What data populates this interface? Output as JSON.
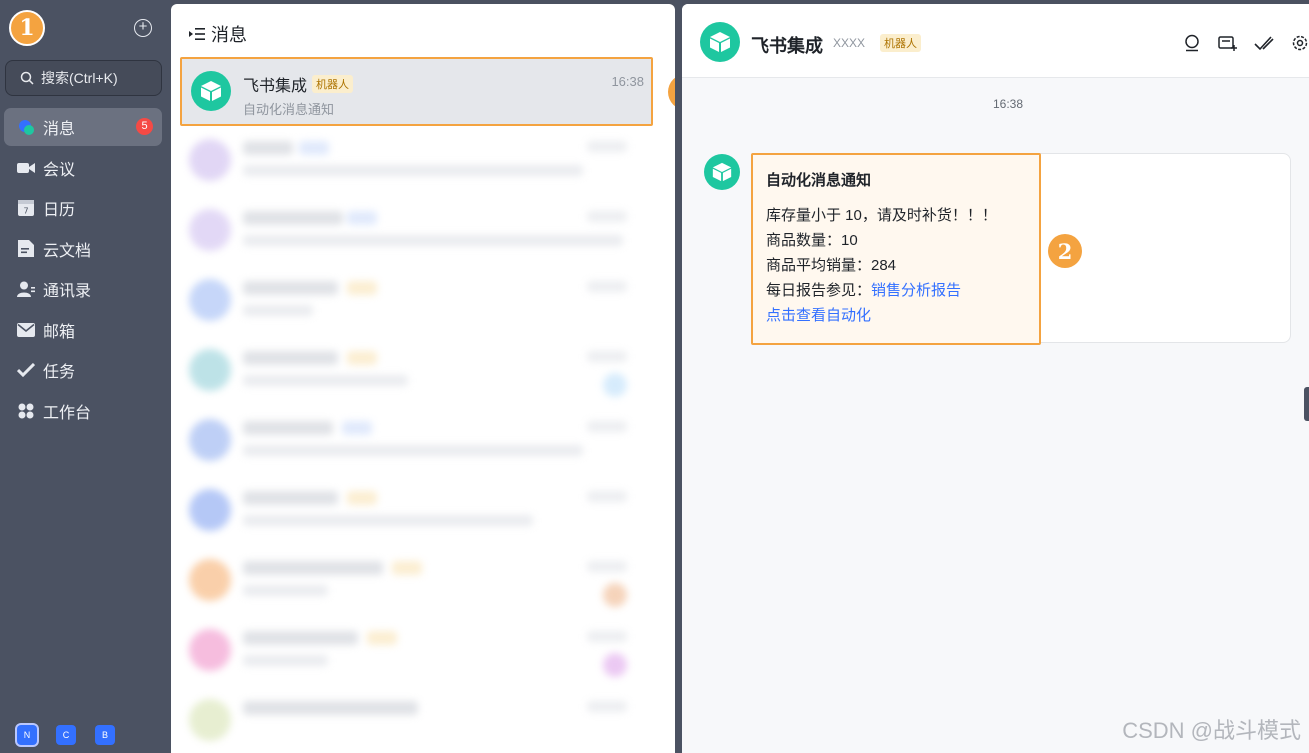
{
  "app": {
    "user_avatar_glyph": "1",
    "search_label": "搜索(Ctrl+K)"
  },
  "sidebar": {
    "items": [
      {
        "label": "消息",
        "icon": "message-icon",
        "badge": "5",
        "active": true
      },
      {
        "label": "会议",
        "icon": "video-icon"
      },
      {
        "label": "日历",
        "icon": "calendar-icon",
        "icon_text": "7"
      },
      {
        "label": "云文档",
        "icon": "document-icon"
      },
      {
        "label": "通讯录",
        "icon": "contacts-icon"
      },
      {
        "label": "邮箱",
        "icon": "mail-icon"
      },
      {
        "label": "任务",
        "icon": "task-check-icon"
      },
      {
        "label": "工作台",
        "icon": "workplace-grid-icon"
      }
    ],
    "bottom_apps": [
      "N",
      "C",
      "B"
    ]
  },
  "message_list": {
    "title": "消息",
    "selected": {
      "name": "飞书集成",
      "tag": "机器人",
      "time": "16:38",
      "preview": "自动化消息通知"
    }
  },
  "annotations": {
    "marker1": "1",
    "marker2": "2"
  },
  "chat": {
    "name": "飞书集成",
    "subtitle": "XXXX",
    "tag": "机器人",
    "timestamp": "16:38",
    "tools": [
      "search-icon",
      "add-window-icon",
      "task-check-icon",
      "settings-icon"
    ],
    "card": {
      "title": "自动化消息通知",
      "line1": "库存量小于 10，请及时补货！！！",
      "line2": "商品数量：10",
      "line3": "商品平均销量：284",
      "line4_prefix": "每日报告参见：",
      "line4_link": "销售分析报告",
      "link2": "点击查看自动化"
    }
  },
  "watermark": "CSDN @战斗模式",
  "colors": {
    "accent_orange": "#f4a340",
    "bot_green": "#1ec7a0",
    "link_blue": "#3370ff",
    "badge_red": "#f54a45",
    "sidebar_bg": "#4b5262"
  }
}
